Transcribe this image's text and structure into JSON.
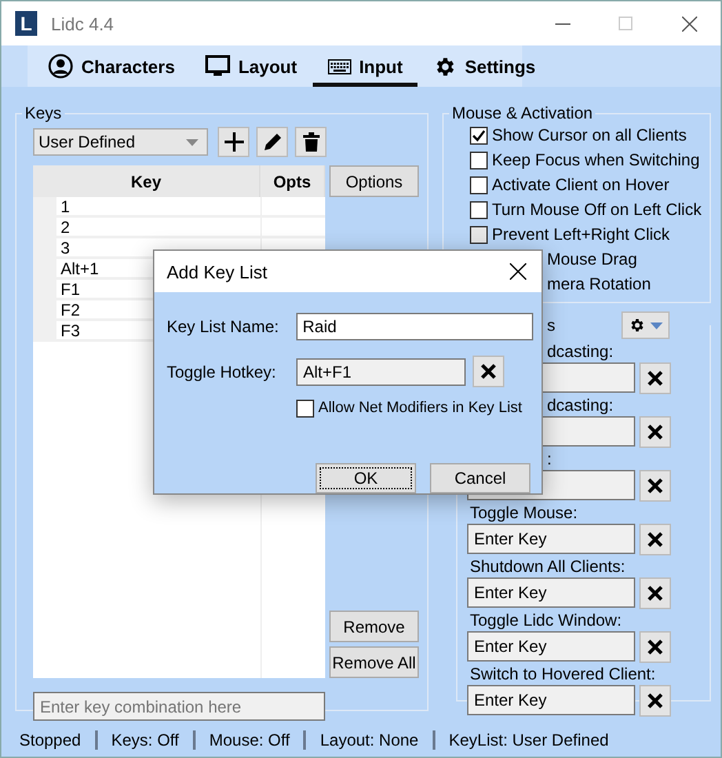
{
  "window": {
    "logo_letter": "L",
    "title": "Lidc 4.4"
  },
  "tabs": [
    {
      "label": "Characters",
      "selected": false
    },
    {
      "label": "Layout",
      "selected": false
    },
    {
      "label": "Input",
      "selected": true
    },
    {
      "label": "Settings",
      "selected": false
    }
  ],
  "keys_group": {
    "title": "Keys",
    "dropdown": "User Defined",
    "columns": [
      "Key",
      "Opts"
    ],
    "rows": [
      "1",
      "2",
      "3",
      "Alt+1",
      "F1",
      "F2",
      "F3"
    ],
    "buttons": [
      "Options",
      "Remove",
      "Remove All"
    ],
    "placeholder": "Enter key combination here"
  },
  "mouse_group": {
    "title": "Mouse & Activation",
    "items": [
      {
        "kind": "checkbox",
        "label": "Show Cursor on all Clients",
        "checked": true,
        "disabled": false
      },
      {
        "kind": "checkbox",
        "label": "Keep Focus when Switching",
        "checked": false,
        "disabled": false
      },
      {
        "kind": "checkbox",
        "label": "Activate Client on Hover",
        "checked": false,
        "disabled": false
      },
      {
        "kind": "checkbox",
        "label": "Turn Mouse Off on Left Click",
        "checked": false,
        "disabled": false
      },
      {
        "kind": "checkbox",
        "label": "Prevent Left+Right Click",
        "checked": false,
        "disabled": true
      },
      {
        "kind": "partial",
        "label": "Mouse Drag"
      },
      {
        "kind": "partial",
        "label": "mera Rotation"
      }
    ]
  },
  "hotkeys_group": {
    "title": "s",
    "items": [
      {
        "kind": "partial",
        "label": "dcasting:"
      },
      {
        "kind": "partial",
        "label": "dcasting:"
      },
      {
        "kind": "partial",
        "label": ":"
      },
      {
        "kind": "full",
        "label": "Toggle Mouse:",
        "value": "Enter Key"
      },
      {
        "kind": "full",
        "label": "Shutdown All Clients:",
        "value": "Enter Key"
      },
      {
        "kind": "full",
        "label": "Toggle Lidc Window:",
        "value": "Enter Key"
      },
      {
        "kind": "full",
        "label": "Switch to Hovered Client:",
        "value": "Enter Key"
      }
    ]
  },
  "status_bar": [
    "Stopped",
    "Keys: Off",
    "Mouse: Off",
    "Layout: None",
    "KeyList: User Defined"
  ],
  "dialog": {
    "title": "Add Key List",
    "name_label": "Key List Name:",
    "name_value": "Raid",
    "hotkey_label": "Toggle Hotkey:",
    "hotkey_value": "Alt+F1",
    "checkbox": {
      "label": "Allow Net Modifiers in Key List",
      "checked": false
    },
    "buttons": [
      "OK",
      "Cancel"
    ]
  }
}
